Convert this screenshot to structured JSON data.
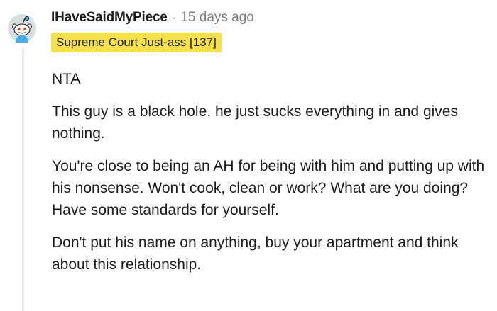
{
  "comment": {
    "username": "IHaveSaidMyPiece",
    "separator": "·",
    "timestamp": "15 days ago",
    "flair": "Supreme Court Just-ass [137]",
    "paragraphs": [
      "NTA",
      "This guy is a black hole, he just sucks everything in and gives nothing.",
      "You're close to being an AH for being with him and putting up with his nonsense. Won't cook, clean or work? What are you doing? Have some standards for yourself.",
      "Don't put his name on anything, buy your apartment and think about this relationship."
    ]
  },
  "colors": {
    "flair_background": "#f7e14a",
    "meta_text": "#7c7c7c",
    "thread_line": "#e6e6e6",
    "avatar_blue": "#47aeef",
    "avatar_bg": "#d7dfe2"
  },
  "icons": {
    "avatar": "reddit-snoo-avatar-icon"
  }
}
